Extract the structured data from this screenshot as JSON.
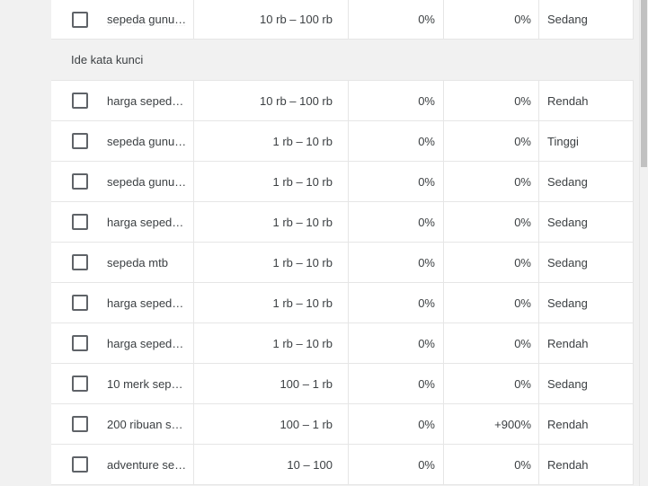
{
  "section_header": "Ide kata kunci",
  "first_row": {
    "keyword": "sepeda gunu…",
    "volume": "10 rb – 100 rb",
    "change_3m": "0%",
    "change_yoy": "0%",
    "competition": "Sedang"
  },
  "rows": [
    {
      "keyword": "harga seped…",
      "volume": "10 rb – 100 rb",
      "change_3m": "0%",
      "change_yoy": "0%",
      "competition": "Rendah"
    },
    {
      "keyword": "sepeda gunu…",
      "volume": "1 rb – 10 rb",
      "change_3m": "0%",
      "change_yoy": "0%",
      "competition": "Tinggi"
    },
    {
      "keyword": "sepeda gunu…",
      "volume": "1 rb – 10 rb",
      "change_3m": "0%",
      "change_yoy": "0%",
      "competition": "Sedang"
    },
    {
      "keyword": "harga seped…",
      "volume": "1 rb – 10 rb",
      "change_3m": "0%",
      "change_yoy": "0%",
      "competition": "Sedang"
    },
    {
      "keyword": "sepeda mtb",
      "volume": "1 rb – 10 rb",
      "change_3m": "0%",
      "change_yoy": "0%",
      "competition": "Sedang"
    },
    {
      "keyword": "harga seped…",
      "volume": "1 rb – 10 rb",
      "change_3m": "0%",
      "change_yoy": "0%",
      "competition": "Sedang"
    },
    {
      "keyword": "harga seped…",
      "volume": "1 rb – 10 rb",
      "change_3m": "0%",
      "change_yoy": "0%",
      "competition": "Rendah"
    },
    {
      "keyword": "10 merk sep…",
      "volume": "100 – 1 rb",
      "change_3m": "0%",
      "change_yoy": "0%",
      "competition": "Sedang"
    },
    {
      "keyword": "200 ribuan s…",
      "volume": "100 – 1 rb",
      "change_3m": "0%",
      "change_yoy": "+900%",
      "competition": "Rendah"
    },
    {
      "keyword": "adventure se…",
      "volume": "10 – 100",
      "change_3m": "0%",
      "change_yoy": "0%",
      "competition": "Rendah"
    }
  ]
}
